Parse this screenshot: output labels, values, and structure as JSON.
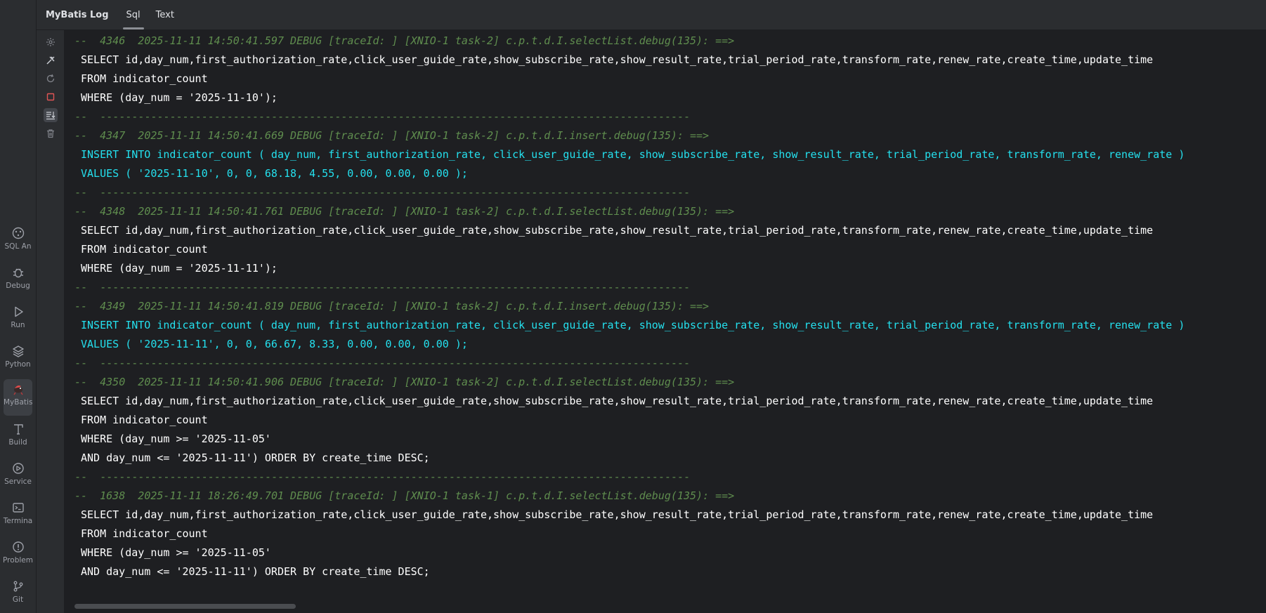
{
  "tool_window": {
    "items": [
      {
        "label": "SQL An",
        "icon": "sql-analyzer-icon"
      },
      {
        "label": "Debug",
        "icon": "bug-icon"
      },
      {
        "label": "Run",
        "icon": "play-icon"
      },
      {
        "label": "Python",
        "icon": "layers-icon"
      },
      {
        "label": "MyBatis",
        "icon": "mybatis-bird-icon",
        "active": true
      },
      {
        "label": "Build",
        "icon": "hammer-icon"
      },
      {
        "label": "Service",
        "icon": "services-icon"
      },
      {
        "label": "Termina",
        "icon": "terminal-icon"
      },
      {
        "label": "Problem",
        "icon": "problems-icon"
      },
      {
        "label": "Git",
        "icon": "git-branch-icon"
      }
    ]
  },
  "header": {
    "title": "MyBatis Log",
    "tabs": [
      {
        "label": "Sql",
        "selected": true
      },
      {
        "label": "Text",
        "selected": false
      }
    ]
  },
  "actions": [
    {
      "name": "settings",
      "icon": "gear-icon"
    },
    {
      "name": "filter",
      "icon": "hammer-settings-icon"
    },
    {
      "name": "rerun",
      "icon": "refresh-icon"
    },
    {
      "name": "stop",
      "icon": "stop-icon",
      "color": "#e05555"
    },
    {
      "name": "scroll-to-end",
      "icon": "scroll-to-end-icon",
      "toggled": true
    },
    {
      "name": "clear",
      "icon": "trash-icon"
    }
  ],
  "colors": {
    "comment": "#5f8d4e",
    "sql_select": "#ffffff",
    "sql_insert": "#24e0ee",
    "background": "#1e1f22"
  },
  "console": {
    "lines": [
      {
        "type": "comment",
        "text": "--  4346  2025-11-11 14:50:41.597 DEBUG [traceId: ] [XNIO-1 task-2] c.p.t.d.I.selectList.debug(135): ==>"
      },
      {
        "type": "sql",
        "text": "SELECT id,day_num,first_authorization_rate,click_user_guide_rate,show_subscribe_rate,show_result_rate,trial_period_rate,transform_rate,renew_rate,create_time,update_time"
      },
      {
        "type": "sql",
        "text": "FROM indicator_count"
      },
      {
        "type": "sql",
        "text": "WHERE (day_num = '2025-11-10');"
      },
      {
        "type": "sep",
        "text": "--  ---------------------------------------------------------------------------------------------"
      },
      {
        "type": "comment",
        "text": "--  4347  2025-11-11 14:50:41.669 DEBUG [traceId: ] [XNIO-1 task-2] c.p.t.d.I.insert.debug(135): ==>"
      },
      {
        "type": "insert",
        "text": "INSERT INTO indicator_count ( day_num, first_authorization_rate, click_user_guide_rate, show_subscribe_rate, show_result_rate, trial_period_rate, transform_rate, renew_rate )"
      },
      {
        "type": "insert",
        "text": "VALUES ( '2025-11-10', 0, 0, 68.18, 4.55, 0.00, 0.00, 0.00 );"
      },
      {
        "type": "sep",
        "text": "--  ---------------------------------------------------------------------------------------------"
      },
      {
        "type": "comment",
        "text": "--  4348  2025-11-11 14:50:41.761 DEBUG [traceId: ] [XNIO-1 task-2] c.p.t.d.I.selectList.debug(135): ==>"
      },
      {
        "type": "sql",
        "text": "SELECT id,day_num,first_authorization_rate,click_user_guide_rate,show_subscribe_rate,show_result_rate,trial_period_rate,transform_rate,renew_rate,create_time,update_time"
      },
      {
        "type": "sql",
        "text": "FROM indicator_count"
      },
      {
        "type": "sql",
        "text": "WHERE (day_num = '2025-11-11');"
      },
      {
        "type": "sep",
        "text": "--  ---------------------------------------------------------------------------------------------"
      },
      {
        "type": "comment",
        "text": "--  4349  2025-11-11 14:50:41.819 DEBUG [traceId: ] [XNIO-1 task-2] c.p.t.d.I.insert.debug(135): ==>"
      },
      {
        "type": "insert",
        "text": "INSERT INTO indicator_count ( day_num, first_authorization_rate, click_user_guide_rate, show_subscribe_rate, show_result_rate, trial_period_rate, transform_rate, renew_rate )"
      },
      {
        "type": "insert",
        "text": "VALUES ( '2025-11-11', 0, 0, 66.67, 8.33, 0.00, 0.00, 0.00 );"
      },
      {
        "type": "sep",
        "text": "--  ---------------------------------------------------------------------------------------------"
      },
      {
        "type": "comment",
        "text": "--  4350  2025-11-11 14:50:41.906 DEBUG [traceId: ] [XNIO-1 task-2] c.p.t.d.I.selectList.debug(135): ==>"
      },
      {
        "type": "sql",
        "text": "SELECT id,day_num,first_authorization_rate,click_user_guide_rate,show_subscribe_rate,show_result_rate,trial_period_rate,transform_rate,renew_rate,create_time,update_time"
      },
      {
        "type": "sql",
        "text": "FROM indicator_count"
      },
      {
        "type": "sql",
        "text": "WHERE (day_num >= '2025-11-05'"
      },
      {
        "type": "sql",
        "text": "AND day_num <= '2025-11-11') ORDER BY create_time DESC;"
      },
      {
        "type": "sep",
        "text": "--  ---------------------------------------------------------------------------------------------"
      },
      {
        "type": "comment",
        "text": "--  1638  2025-11-11 18:26:49.701 DEBUG [traceId: ] [XNIO-1 task-1] c.p.t.d.I.selectList.debug(135): ==>"
      },
      {
        "type": "sql",
        "text": "SELECT id,day_num,first_authorization_rate,click_user_guide_rate,show_subscribe_rate,show_result_rate,trial_period_rate,transform_rate,renew_rate,create_time,update_time"
      },
      {
        "type": "sql",
        "text": "FROM indicator_count"
      },
      {
        "type": "sql",
        "text": "WHERE (day_num >= '2025-11-05'"
      },
      {
        "type": "sql",
        "text": "AND day_num <= '2025-11-11') ORDER BY create_time DESC;"
      }
    ]
  }
}
